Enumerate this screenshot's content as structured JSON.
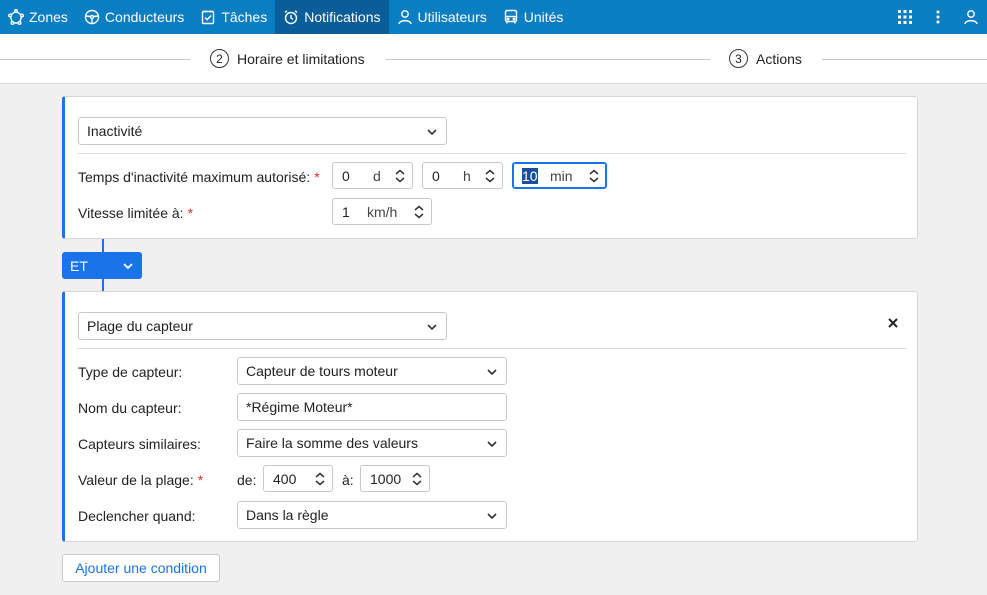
{
  "nav": {
    "items": [
      {
        "label": "Zones",
        "icon": "zones-icon"
      },
      {
        "label": "Conducteurs",
        "icon": "steering-wheel-icon"
      },
      {
        "label": "Tâches",
        "icon": "task-check-icon"
      },
      {
        "label": "Notifications",
        "icon": "alarm-clock-icon",
        "active": true
      },
      {
        "label": "Utilisateurs",
        "icon": "user-icon"
      },
      {
        "label": "Unités",
        "icon": "bus-icon"
      }
    ],
    "right_icons": [
      "apps-grid-icon",
      "more-vertical-icon",
      "account-icon"
    ],
    "bg_color": "#0a7ec2",
    "active_color": "#095d99"
  },
  "stepper": {
    "steps": [
      {
        "num": "2",
        "label": "Horaire et limitations"
      },
      {
        "num": "3",
        "label": "Actions"
      }
    ]
  },
  "card1": {
    "type_select": "Inactivité",
    "fields": {
      "idle_label": "Temps d'inactivité maximum autorisé:",
      "idle_days": {
        "value": "0",
        "unit": "d"
      },
      "idle_hours": {
        "value": "0",
        "unit": "h"
      },
      "idle_minutes": {
        "value": "10",
        "unit": "min"
      },
      "speed_label": "Vitesse limitée à:",
      "speed": {
        "value": "1",
        "unit": "km/h"
      }
    },
    "required_mark": "*"
  },
  "connector": {
    "label": "ET"
  },
  "card2": {
    "type_select": "Plage du capteur",
    "fields": {
      "sensor_type_label": "Type de capteur:",
      "sensor_type_value": "Capteur de tours moteur",
      "sensor_name_label": "Nom du capteur:",
      "sensor_name_value": "*Régime Moteur*",
      "similar_label": "Capteurs similaires:",
      "similar_value": "Faire la somme des valeurs",
      "range_label": "Valeur de la plage:",
      "range_from_label": "de:",
      "range_from": "400",
      "range_to_label": "à:",
      "range_to": "1000",
      "trigger_label": "Declencher quand:",
      "trigger_value": "Dans la règle"
    },
    "required_mark": "*"
  },
  "add_condition_label": "Ajouter une condition",
  "colors": {
    "accent": "#1a73e8",
    "required": "#d32f2f"
  }
}
